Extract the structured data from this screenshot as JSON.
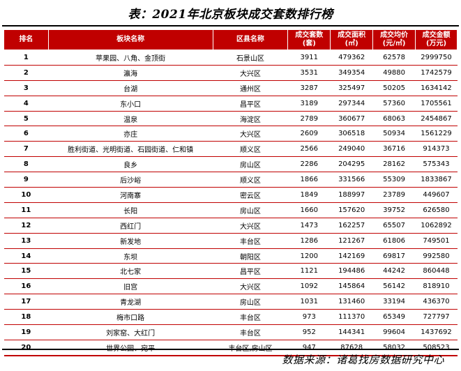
{
  "title": "表：2021年北京板块成交套数排行榜",
  "source": "数据来源：诸葛找房数据研究中心",
  "colors": {
    "header_bg": "#c00000",
    "rule": "#000000"
  },
  "headers": {
    "rank": "排名",
    "block": "板块名称",
    "district": "区县名称",
    "units_l1": "成交套数",
    "units_l2": "(套)",
    "area_l1": "成交面积",
    "area_l2": "(㎡)",
    "price_l1": "成交均价",
    "price_l2": "(元/㎡)",
    "amount_l1": "成交金额",
    "amount_l2": "(万元)"
  },
  "rows": [
    {
      "rank": "1",
      "block": "苹果园、八角、金顶街",
      "district": "石景山区",
      "units": "3911",
      "area": "479362",
      "price": "62578",
      "amount": "2999750"
    },
    {
      "rank": "2",
      "block": "瀛海",
      "district": "大兴区",
      "units": "3531",
      "area": "349354",
      "price": "49880",
      "amount": "1742579"
    },
    {
      "rank": "3",
      "block": "台湖",
      "district": "通州区",
      "units": "3287",
      "area": "325497",
      "price": "50205",
      "amount": "1634142"
    },
    {
      "rank": "4",
      "block": "东小口",
      "district": "昌平区",
      "units": "3189",
      "area": "297344",
      "price": "57360",
      "amount": "1705561"
    },
    {
      "rank": "5",
      "block": "温泉",
      "district": "海淀区",
      "units": "2789",
      "area": "360677",
      "price": "68063",
      "amount": "2454867"
    },
    {
      "rank": "6",
      "block": "亦庄",
      "district": "大兴区",
      "units": "2609",
      "area": "306518",
      "price": "50934",
      "amount": "1561229"
    },
    {
      "rank": "7",
      "block": "胜利街道、光明街道、石园街道、仁和镇",
      "district": "顺义区",
      "units": "2566",
      "area": "249040",
      "price": "36716",
      "amount": "914373"
    },
    {
      "rank": "8",
      "block": "良乡",
      "district": "房山区",
      "units": "2286",
      "area": "204295",
      "price": "28162",
      "amount": "575343"
    },
    {
      "rank": "9",
      "block": "后沙峪",
      "district": "顺义区",
      "units": "1866",
      "area": "331566",
      "price": "55309",
      "amount": "1833867"
    },
    {
      "rank": "10",
      "block": "河南寨",
      "district": "密云区",
      "units": "1849",
      "area": "188997",
      "price": "23789",
      "amount": "449607"
    },
    {
      "rank": "11",
      "block": "长阳",
      "district": "房山区",
      "units": "1660",
      "area": "157620",
      "price": "39752",
      "amount": "626580"
    },
    {
      "rank": "12",
      "block": "西红门",
      "district": "大兴区",
      "units": "1473",
      "area": "162257",
      "price": "65507",
      "amount": "1062892"
    },
    {
      "rank": "13",
      "block": "新发地",
      "district": "丰台区",
      "units": "1286",
      "area": "121267",
      "price": "61806",
      "amount": "749501"
    },
    {
      "rank": "14",
      "block": "东坝",
      "district": "朝阳区",
      "units": "1200",
      "area": "142169",
      "price": "69817",
      "amount": "992580"
    },
    {
      "rank": "15",
      "block": "北七家",
      "district": "昌平区",
      "units": "1121",
      "area": "194486",
      "price": "44242",
      "amount": "860448"
    },
    {
      "rank": "16",
      "block": "旧宫",
      "district": "大兴区",
      "units": "1092",
      "area": "145864",
      "price": "56142",
      "amount": "818910"
    },
    {
      "rank": "17",
      "block": "青龙湖",
      "district": "房山区",
      "units": "1031",
      "area": "131460",
      "price": "33194",
      "amount": "436370"
    },
    {
      "rank": "18",
      "block": "梅市口路",
      "district": "丰台区",
      "units": "973",
      "area": "111370",
      "price": "65349",
      "amount": "727797"
    },
    {
      "rank": "19",
      "block": "刘家窑、大红门",
      "district": "丰台区",
      "units": "952",
      "area": "144341",
      "price": "99604",
      "amount": "1437692"
    },
    {
      "rank": "20",
      "block": "世界公园、宛平",
      "district": "丰台区,房山区",
      "units": "947",
      "area": "87628",
      "price": "58032",
      "amount": "508523"
    }
  ]
}
